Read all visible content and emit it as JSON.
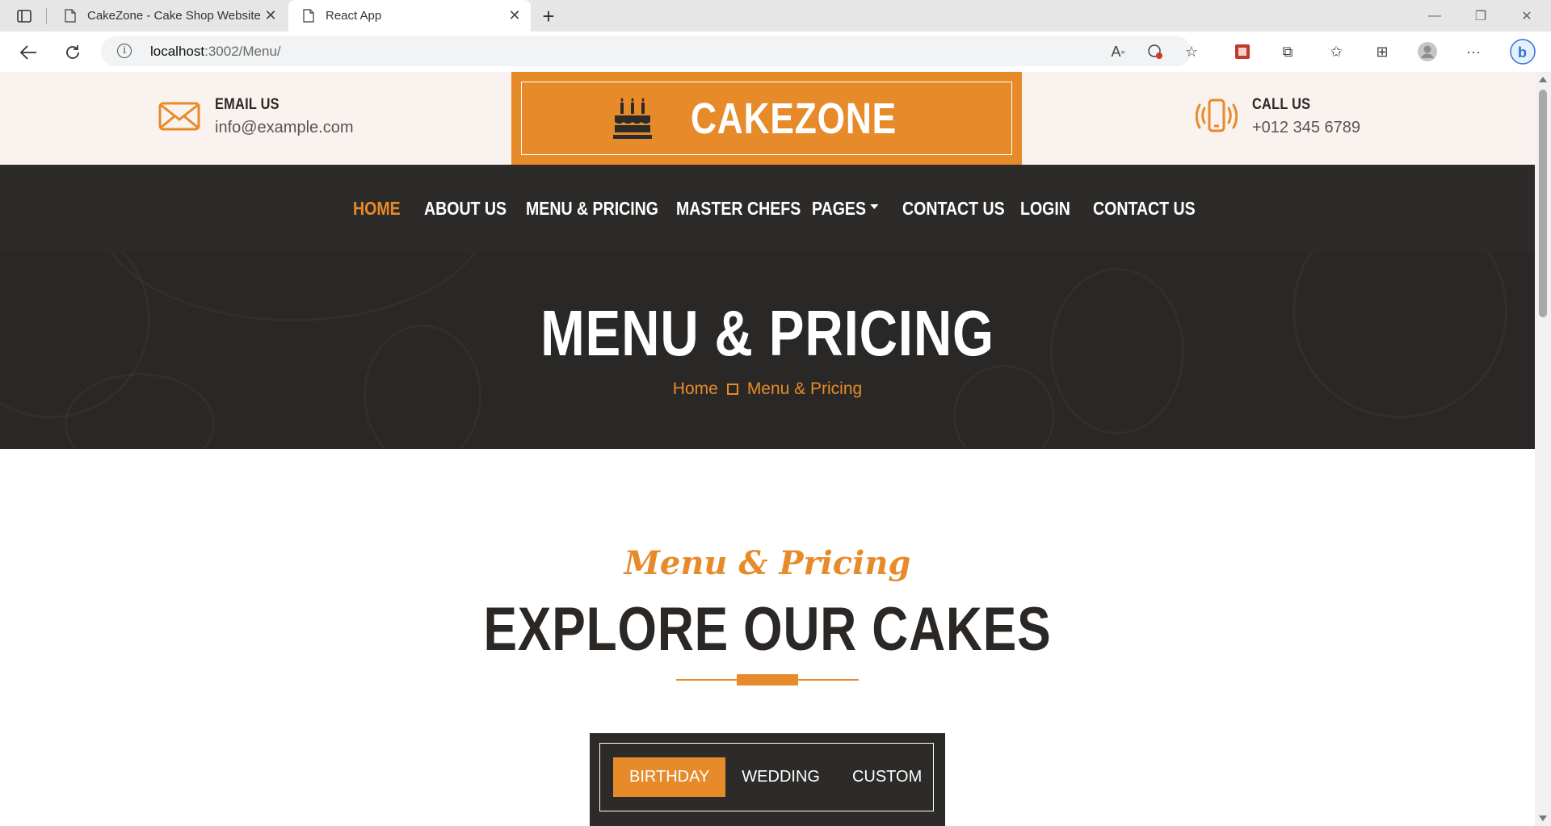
{
  "browser": {
    "tabs": [
      {
        "title": "CakeZone - Cake Shop Website T",
        "active": false
      },
      {
        "title": "React App",
        "active": true
      }
    ],
    "url_host": "localhost",
    "url_path": ":3002/Menu/"
  },
  "topbar": {
    "email": {
      "title": "EMAIL US",
      "value": "info@example.com"
    },
    "call": {
      "title": "CALL US",
      "value": "+012 345 6789"
    },
    "logo": "CAKEZONE"
  },
  "nav": {
    "items": [
      {
        "label": "HOME",
        "active": true
      },
      {
        "label": "ABOUT US"
      },
      {
        "label": "MENU & PRICING"
      },
      {
        "label": "MASTER CHEFS"
      },
      {
        "label": "PAGES"
      },
      {
        "label": "CONTACT US"
      },
      {
        "label": "LOGIN"
      },
      {
        "label": "CONTACT US"
      }
    ]
  },
  "page_header": {
    "title": "MENU & PRICING",
    "breadcrumb": [
      "Home",
      "Menu & Pricing"
    ]
  },
  "section": {
    "subtitle": "Menu & Pricing",
    "title": "EXPLORE OUR CAKES",
    "categories": [
      {
        "label": "BIRTHDAY",
        "active": true
      },
      {
        "label": "WEDDING"
      },
      {
        "label": "CUSTOM"
      }
    ]
  },
  "colors": {
    "accent": "#e78b2a",
    "dark": "#2d2b29",
    "light_bg": "#faf2ee"
  }
}
